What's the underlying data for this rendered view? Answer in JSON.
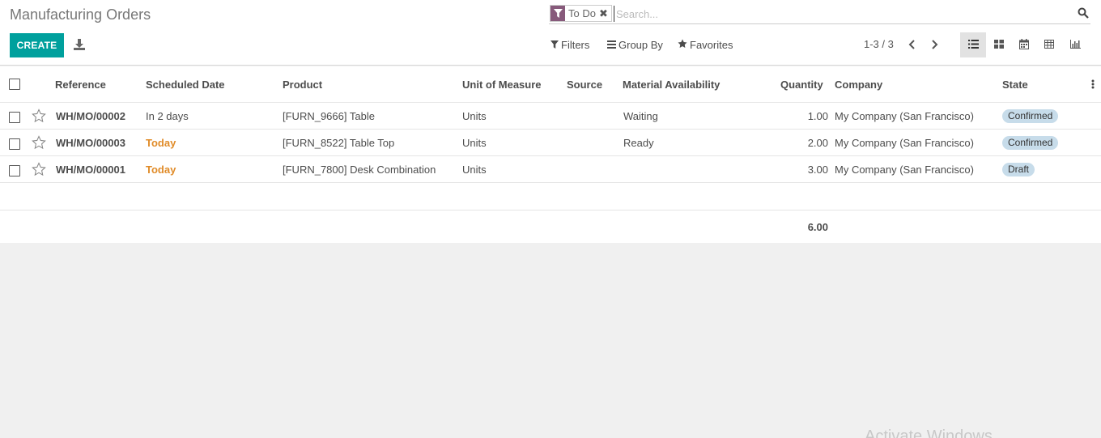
{
  "header": {
    "title": "Manufacturing Orders",
    "create_label": "CREATE"
  },
  "search": {
    "facet_label": "To Do",
    "placeholder": "Search..."
  },
  "filters": {
    "filters_label": "Filters",
    "groupby_label": "Group By",
    "favorites_label": "Favorites"
  },
  "pager": {
    "value": "1-3 / 3"
  },
  "table": {
    "columns": [
      "Reference",
      "Scheduled Date",
      "Product",
      "Unit of Measure",
      "Source",
      "Material Availability",
      "Quantity",
      "Company",
      "State"
    ],
    "rows": [
      {
        "reference": "WH/MO/00002",
        "scheduled": "In 2 days",
        "product": "[FURN_9666] Table",
        "uom": "Units",
        "source": "",
        "availability": "Waiting",
        "quantity": "1.00",
        "company": "My Company (San Francisco)",
        "state": "Confirmed"
      },
      {
        "reference": "WH/MO/00003",
        "scheduled": "Today",
        "product": "[FURN_8522] Table Top",
        "uom": "Units",
        "source": "",
        "availability": "Ready",
        "quantity": "2.00",
        "company": "My Company (San Francisco)",
        "state": "Confirmed"
      },
      {
        "reference": "WH/MO/00001",
        "scheduled": "Today",
        "product": "[FURN_7800] Desk Combination",
        "uom": "Units",
        "source": "",
        "availability": "",
        "quantity": "3.00",
        "company": "My Company (San Francisco)",
        "state": "Draft"
      }
    ],
    "total_quantity": "6.00"
  },
  "watermark": "Activate Windows",
  "colors": {
    "primary": "#00a09d",
    "facet": "#875a7b",
    "today": "#e08b28",
    "badge": "#c7dcea"
  }
}
